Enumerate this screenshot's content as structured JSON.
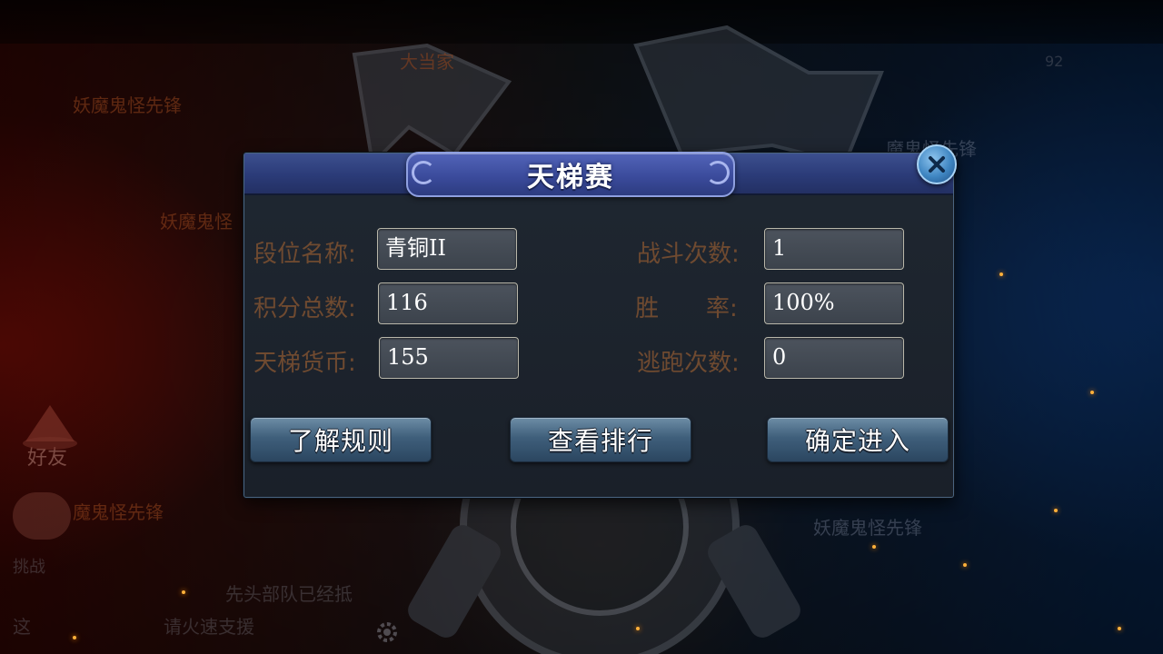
{
  "dialog": {
    "title": "天梯赛",
    "fields_left": [
      {
        "label": "段位名称:",
        "value": "青铜II"
      },
      {
        "label": "积分总数:",
        "value": "116"
      },
      {
        "label": "天梯货币:",
        "value": "155"
      }
    ],
    "fields_right": [
      {
        "label": "战斗次数:",
        "value": "1"
      },
      {
        "label": "胜　　率:",
        "value": "100%"
      },
      {
        "label": "逃跑次数:",
        "value": "0"
      }
    ],
    "buttons": {
      "rules": "了解规则",
      "ranking": "查看排行",
      "enter": "确定进入"
    }
  },
  "background": {
    "texts": [
      "大当家",
      "妖魔鬼怪先锋",
      "妖魔鬼怪",
      "好友",
      "挑战",
      "魔鬼怪先锋",
      "先头部队已经抵",
      "这",
      "请火速支援",
      "妖魔鬼怪先锋",
      "魔鬼怪先锋"
    ],
    "level": "92"
  },
  "colors": {
    "label": "#6f4a30",
    "value_text": "#ffffff",
    "title_plate": "#3b4b9c",
    "button": "#3f5f7b"
  },
  "icons": {
    "close": "close-icon",
    "settings": "gear-icon",
    "chat": "chat-bubble-icon",
    "friend": "friend-hat-icon"
  }
}
